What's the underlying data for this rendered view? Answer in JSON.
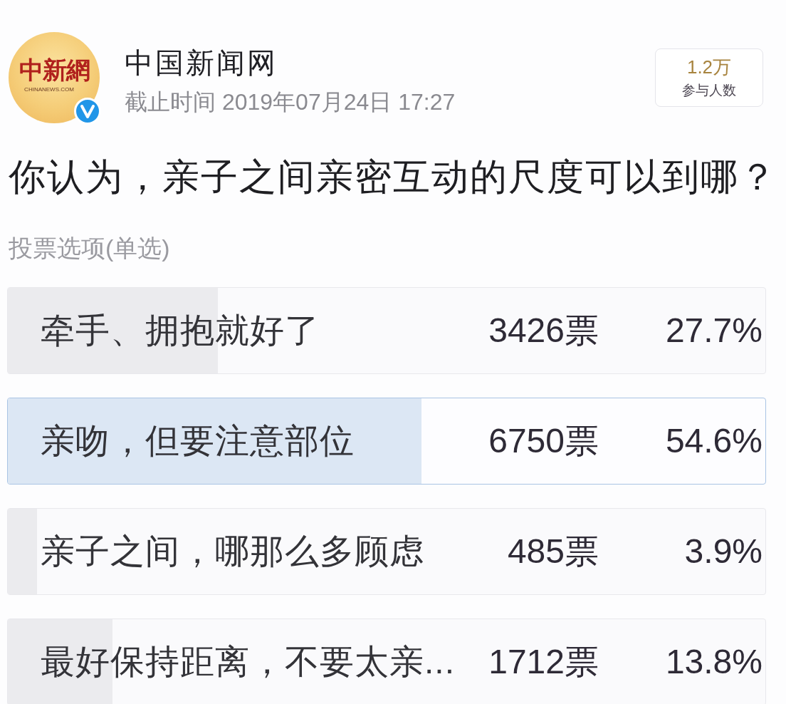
{
  "account": {
    "logo_text": "中新網",
    "logo_subtext": "CHINANEWS.COM",
    "name": "中国新闻网",
    "verified": true,
    "deadline": "截止时间 2019年07月24日 17:27"
  },
  "participants": {
    "count": "1.2万",
    "label": "参与人数"
  },
  "question": "你认为，亲子之间亲密互动的尺度可以到哪？",
  "vote_type": "投票选项(单选)",
  "options": [
    {
      "label": "牵手、拥抱就好了",
      "votes": "3426票",
      "percent": "27.7%",
      "level": 0.277,
      "selected": false
    },
    {
      "label": "亲吻，但要注意部位",
      "votes": "6750票",
      "percent": "54.6%",
      "level": 0.546,
      "selected": true
    },
    {
      "label": "亲子之间，哪那么多顾虑",
      "votes": "485票",
      "percent": "3.9%",
      "level": 0.039,
      "selected": false
    },
    {
      "label": "最好保持距离，不要太亲...",
      "votes": "1712票",
      "percent": "13.8%",
      "level": 0.138,
      "selected": false
    }
  ]
}
